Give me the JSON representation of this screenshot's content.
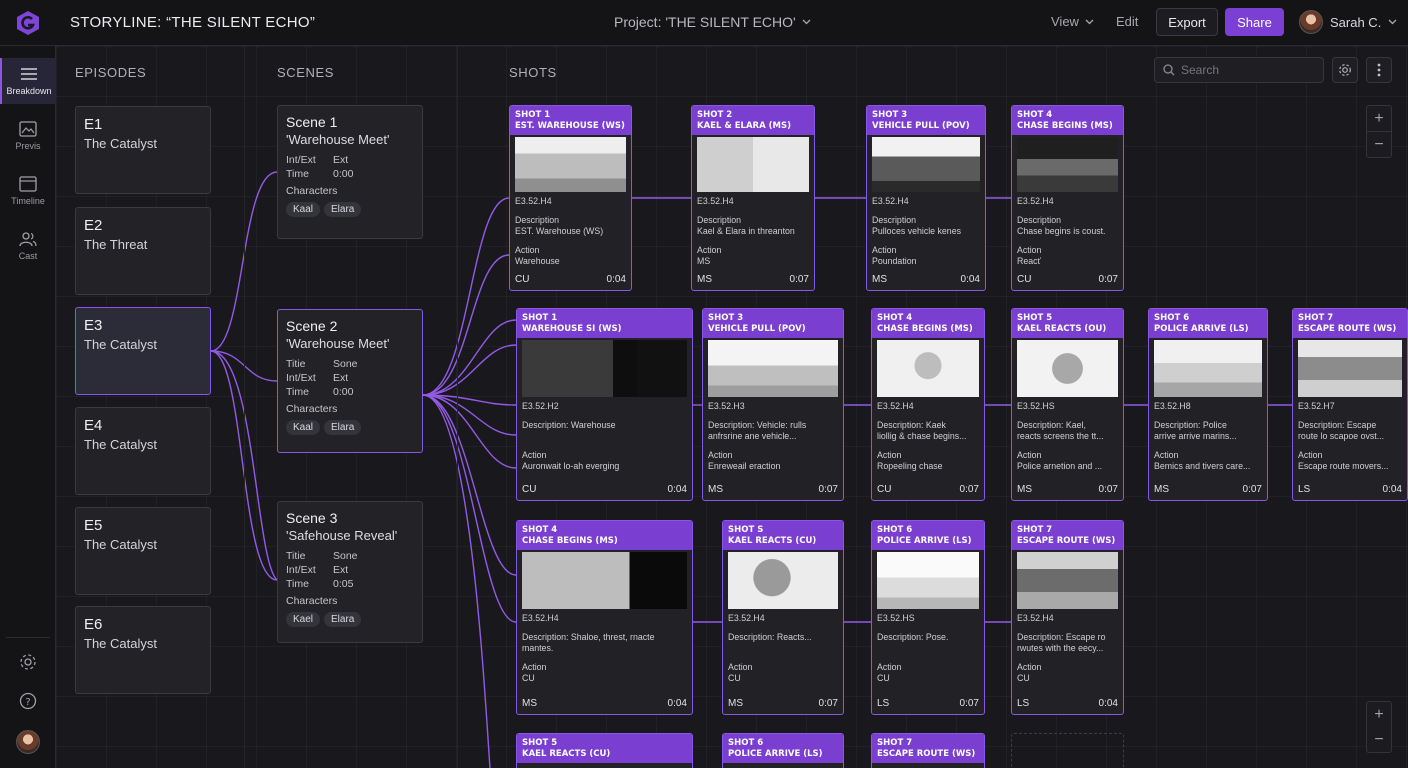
{
  "header": {
    "app_title": "STORYLINE: “THE SILENT ECHO”",
    "project_title": "Project: 'THE SILENT ECHO'",
    "view_label": "View",
    "edit_label": "Edit",
    "export_label": "Export",
    "share_label": "Share",
    "user_name": "Sarah C."
  },
  "sidebar": {
    "items": [
      {
        "label": "Breakdown",
        "icon": "list-icon"
      },
      {
        "label": "Previs",
        "icon": "image-icon"
      },
      {
        "label": "Timeline",
        "icon": "timeline-icon"
      },
      {
        "label": "Cast",
        "icon": "people-icon"
      }
    ]
  },
  "columns": {
    "episodes": "EPISODES",
    "scenes": "SCENES",
    "shots": "SHOTS"
  },
  "search": {
    "placeholder": "Search"
  },
  "episodes": [
    {
      "code": "E1",
      "name": "The Catalyst"
    },
    {
      "code": "E2",
      "name": "The Threat"
    },
    {
      "code": "E3",
      "name": "The Catalyst"
    },
    {
      "code": "E4",
      "name": "The Catalyst"
    },
    {
      "code": "E5",
      "name": "The Catalyst"
    },
    {
      "code": "E6",
      "name": "The Catalyst"
    }
  ],
  "scenes": [
    {
      "title": "Scene 1",
      "subtitle": "'Warehouse Meet'",
      "rows": [
        {
          "k": "Int/Ext",
          "v": "Ext"
        },
        {
          "k": "Time",
          "v": "0:00"
        }
      ],
      "characters_label": "Characters",
      "characters": [
        "Kaal",
        "Elara"
      ]
    },
    {
      "title": "Scene 2",
      "subtitle": "'Warehouse Meet'",
      "rows": [
        {
          "k": "Titie",
          "v": "Sone"
        },
        {
          "k": "Int/Ext",
          "v": "Ext"
        },
        {
          "k": "Time",
          "v": "0:00"
        }
      ],
      "characters_label": "Characters",
      "characters": [
        "Kaal",
        "Elara"
      ]
    },
    {
      "title": "Scene 3",
      "subtitle": "'Safehouse Reveal'",
      "rows": [
        {
          "k": "Titie",
          "v": "Sone"
        },
        {
          "k": "Int/Ext",
          "v": "Ext"
        },
        {
          "k": "Time",
          "v": "0:05"
        }
      ],
      "characters_label": "Characters",
      "characters": [
        "Kael",
        "Elara"
      ]
    }
  ],
  "shots": [
    {
      "t1": "SHOT 1",
      "t2": "EST. WAREHOUSE (WS)",
      "code": "E3.52.H4",
      "desc": "Description",
      "desc2": "EST. Warehouse (WS)",
      "act": "Action",
      "act2": "Warehouse",
      "size": "CU",
      "dur": "0:04"
    },
    {
      "t1": "SHOT 2",
      "t2": "KAEL & ELARA (MS)",
      "code": "E3.52.H4",
      "desc": "Description",
      "desc2": "Kael & Elara in threanton",
      "act": "Action",
      "act2": "MS",
      "size": "MS",
      "dur": "0:07"
    },
    {
      "t1": "SHOT 3",
      "t2": "VEHICLE PULL (POV)",
      "code": "E3.52.H4",
      "desc": "Description",
      "desc2": "Pulloces vehicle kenes",
      "act": "Action",
      "act2": "Poundation",
      "size": "MS",
      "dur": "0:04"
    },
    {
      "t1": "SHOT 4",
      "t2": "CHASE BEGINS (MS)",
      "code": "E3.52.H4",
      "desc": "Description",
      "desc2": "Chase begins is coust.",
      "act": "Action",
      "act2": "Reacť",
      "size": "CU",
      "dur": "0:07"
    },
    {
      "t1": "SHOT 1",
      "t2": "WAREHOUSE SI (WS)",
      "code": "E3.52.H2",
      "desc": "Description: Warehouse",
      "desc2": "",
      "act": "Action",
      "act2": "Auronwait lo-ah everging",
      "size": "CU",
      "dur": "0:04"
    },
    {
      "t1": "SHOT 3",
      "t2": "VEHICLE PULL (POV)",
      "code": "E3.52.H3",
      "desc": "Description: Vehicle: rulls",
      "desc2": "anfrsrine ane vehicle...",
      "act": "Action",
      "act2": "Enreweail eraction",
      "size": "MS",
      "dur": "0:07"
    },
    {
      "t1": "SHOT 4",
      "t2": "CHASE BEGINS (MS)",
      "code": "E3.52.H4",
      "desc": "Description: Kaek",
      "desc2": "liollig & chase begins...",
      "act": "Action",
      "act2": "Ropeeling chase",
      "size": "CU",
      "dur": "0:07"
    },
    {
      "t1": "SHOT 5",
      "t2": "KAEL REACTS (OU)",
      "code": "E3.52.HS",
      "desc": "Description: Kael,",
      "desc2": "reacts screens the tt...",
      "act": "Action",
      "act2": "Police arnetion and ...",
      "size": "MS",
      "dur": "0:07"
    },
    {
      "t1": "SHOT 6",
      "t2": "POLICE ARRIVE (LS)",
      "code": "E3.52.H8",
      "desc": "Description: Police",
      "desc2": "arrive arrive marins...",
      "act": "Action",
      "act2": "Bemics and tivers care...",
      "size": "MS",
      "dur": "0:07"
    },
    {
      "t1": "SHOT 7",
      "t2": "ESCAPE ROUTE (WS)",
      "code": "E3.52.H7",
      "desc": "Description: Escape",
      "desc2": "route lo scapoe ovst...",
      "act": "Action",
      "act2": "Escape route movers...",
      "size": "LS",
      "dur": "0:04"
    },
    {
      "t1": "SHOT 4",
      "t2": "CHASE BEGINS (MS)",
      "code": "E3.52.H4",
      "desc": "Description: Shaloe, threst, rnacte",
      "desc2": "mantes.",
      "act": "Action",
      "act2": "CU",
      "size": "MS",
      "dur": "0:04"
    },
    {
      "t1": "SHOT S",
      "t2": "KAEL REACTS (CU)",
      "code": "E3.52.H4",
      "desc": "Description: Reacts...",
      "desc2": "",
      "act": "Action",
      "act2": "CU",
      "size": "MS",
      "dur": "0:07"
    },
    {
      "t1": "SHOT 6",
      "t2": "POLICE ARRIVE (LS)",
      "code": "E3.52.HS",
      "desc": "Description: Pose.",
      "desc2": "",
      "act": "Action",
      "act2": "CU",
      "size": "LS",
      "dur": "0:07"
    },
    {
      "t1": "SHOT 7",
      "t2": "ESCAPE ROUTE (WS)",
      "code": "E3.52.H4",
      "desc": "Description: Escape ro",
      "desc2": "rwutes with the eecy...",
      "act": "Action",
      "act2": "CU",
      "size": "LS",
      "dur": "0:04"
    },
    {
      "t1": "SHOT 5",
      "t2": "KAEL REACTS (CU)"
    },
    {
      "t1": "SHOT 6",
      "t2": "POLICE ARRIVE (LS)"
    },
    {
      "t1": "SHOT 7",
      "t2": "ESCAPE ROUTE (WS)"
    }
  ],
  "colors": {
    "accent": "#7c3fd4",
    "accent_border": "#8a55e8",
    "connector": "#9a5ef0",
    "background": "#17171b"
  }
}
